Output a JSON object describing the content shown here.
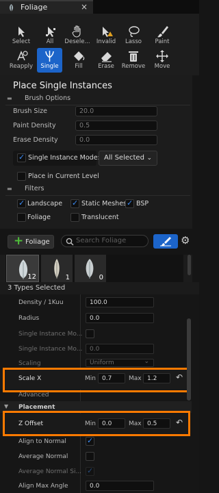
{
  "tab": {
    "title": "Foliage",
    "close_glyph": "×"
  },
  "toolbar": {
    "row1": [
      {
        "label": "Select",
        "icon": "cursor-icon"
      },
      {
        "label": "All",
        "icon": "select-all-icon"
      },
      {
        "label": "Desele...",
        "icon": "deselect-hand-icon"
      },
      {
        "label": "Invalid",
        "icon": "invalid-select-icon"
      },
      {
        "label": "Lasso",
        "icon": "lasso-icon"
      },
      {
        "label": "Paint",
        "icon": "paint-brush-icon"
      }
    ],
    "row2": [
      {
        "label": "Reapply",
        "icon": "reapply-icon"
      },
      {
        "label": "Single",
        "icon": "single-instance-icon",
        "active": true
      },
      {
        "label": "Fill",
        "icon": "fill-bucket-icon"
      },
      {
        "label": "Erase",
        "icon": "eraser-icon"
      },
      {
        "label": "Remove",
        "icon": "remove-trash-icon"
      },
      {
        "label": "Move",
        "icon": "move-icon"
      }
    ]
  },
  "place": {
    "title": "Place Single Instances",
    "brush_options_header": "Brush Options",
    "brush_size_label": "Brush Size",
    "brush_size_value": "20.0",
    "paint_density_label": "Paint Density",
    "paint_density_value": "0.5",
    "erase_density_label": "Erase Density",
    "erase_density_value": "0.0",
    "single_mode_label": "Single Instance Mode:",
    "single_mode_value": "All Selected",
    "place_current_label": "Place in Current Level",
    "filters_header": "Filters",
    "filters": {
      "landscape": "Landscape",
      "static_meshes": "Static Meshes",
      "bsp": "BSP",
      "foliage": "Foliage",
      "translucent": "Translucent"
    }
  },
  "foliage_bar": {
    "add_label": "Foliage",
    "search_placeholder": "Search Foliage",
    "thumbnails": [
      {
        "count": "12"
      },
      {
        "count": "1"
      },
      {
        "count": "0"
      }
    ]
  },
  "details": {
    "types_selected": "3 Types Selected",
    "density_label": "Density / 1Kuu",
    "density_value": "100.0",
    "radius_label": "Radius",
    "radius_value": "0.0",
    "single_mo1_label": "Single Instance Mo...",
    "single_mo2_label": "Single Instance Mo...",
    "single_mo2_value": "0.0",
    "scaling_label": "Scaling",
    "scaling_value": "Uniform",
    "scale_x_label": "Scale X",
    "scale_x_min_label": "Min",
    "scale_x_min": "0.7",
    "scale_x_max_label": "Max",
    "scale_x_max": "1.2",
    "advanced_label": "Advanced",
    "placement_label": "Placement",
    "z_offset_label": "Z Offset",
    "z_offset_min_label": "Min",
    "z_offset_min": "0.0",
    "z_offset_max_label": "Max",
    "z_offset_max": "0.5",
    "align_normal_label": "Align to Normal",
    "average_normal_label": "Average Normal",
    "average_normal_si_label": "Average Normal Si...",
    "align_max_angle_label": "Align Max Angle",
    "align_max_angle_value": "0.0"
  },
  "colors": {
    "accent": "#1c64c9",
    "highlight": "#ff7a00",
    "add_plus": "#4fbf3a"
  }
}
